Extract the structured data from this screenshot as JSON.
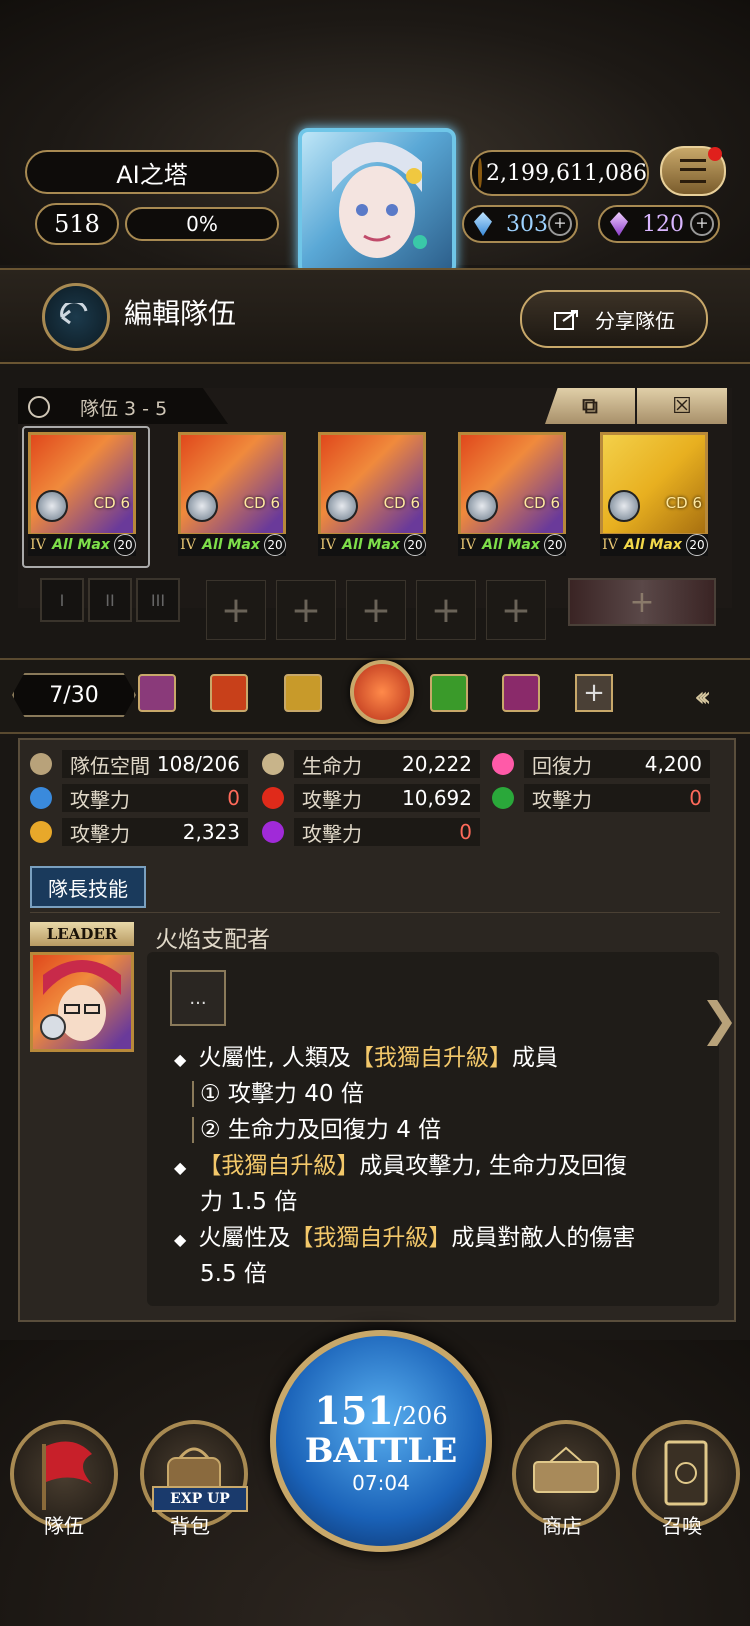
{
  "header": {
    "player_name": "AI之塔",
    "level": "518",
    "exp_percent": "0%",
    "coins": "2,199,611,086",
    "diamonds": "303",
    "crystals": "120"
  },
  "page": {
    "title": "編輯隊伍",
    "share_label": "分享隊伍"
  },
  "team": {
    "label": "隊伍 3 - 5",
    "cards": [
      {
        "rank": "IV",
        "status": "All Max",
        "cd": "CD 6",
        "level": "20",
        "element": "fire"
      },
      {
        "rank": "IV",
        "status": "All Max",
        "cd": "CD 6",
        "level": "20",
        "element": "fire"
      },
      {
        "rank": "IV",
        "status": "All Max",
        "cd": "CD 6",
        "level": "20",
        "element": "fire"
      },
      {
        "rank": "IV",
        "status": "All Max",
        "cd": "CD 6",
        "level": "20",
        "element": "fire"
      },
      {
        "rank": "IV",
        "status": "All Max",
        "cd": "CD 6",
        "level": "20",
        "element": "light"
      }
    ],
    "small_slots": [
      "I",
      "II",
      "III"
    ],
    "plus_slots": [
      "+",
      "+",
      "+",
      "+",
      "+"
    ]
  },
  "team_selector": {
    "count": "7/30",
    "colors": [
      "#8a3a7a",
      "#c8401a",
      "#c89a2a",
      "#e05a2a",
      "#3a9a2a",
      "#8a2a6a"
    ]
  },
  "stats": {
    "rows": [
      [
        {
          "label": "隊伍空間",
          "value": "108/206",
          "icon": "banner-icon",
          "color": "#b8a27a"
        },
        {
          "label": "生命力",
          "value": "20,222",
          "icon": "drop-icon",
          "color": "#c8b48a"
        },
        {
          "label": "回復力",
          "value": "4,200",
          "icon": "heart-icon",
          "color": "#ff5aa8"
        }
      ],
      [
        {
          "label": "攻擊力",
          "value": "0",
          "icon": "water-icon",
          "color": "#3a8adc",
          "zero": true
        },
        {
          "label": "攻擊力",
          "value": "10,692",
          "icon": "fire-icon",
          "color": "#e02a1a"
        },
        {
          "label": "攻擊力",
          "value": "0",
          "icon": "wood-icon",
          "color": "#2aa83a",
          "zero": true
        }
      ],
      [
        {
          "label": "攻擊力",
          "value": "2,323",
          "icon": "light-icon",
          "color": "#e8a82a"
        },
        {
          "label": "攻擊力",
          "value": "0",
          "icon": "dark-icon",
          "color": "#a02ad8",
          "zero": true
        }
      ]
    ]
  },
  "leader": {
    "tab_label": "隊長技能",
    "badge": "LEADER",
    "skill_name": "火焰支配者",
    "ellipsis": "...",
    "lines": [
      {
        "bullet": "◆",
        "parts": [
          {
            "t": "火屬性, 人類及"
          },
          {
            "t": "【我獨自升級】",
            "hl": true
          },
          {
            "t": "成員"
          }
        ]
      },
      {
        "bullet": "",
        "parts": [
          {
            "t": "① 攻擊力 40 倍"
          }
        ],
        "indent": true
      },
      {
        "bullet": "",
        "parts": [
          {
            "t": "② 生命力及回復力 4 倍"
          }
        ],
        "indent": true
      },
      {
        "bullet": "◆",
        "parts": [
          {
            "t": "【我獨自升級】",
            "hl": true
          },
          {
            "t": "成員攻擊力, 生命力及回復"
          }
        ]
      },
      {
        "bullet": "",
        "parts": [
          {
            "t": "力 1.5 倍"
          }
        ]
      },
      {
        "bullet": "◆",
        "parts": [
          {
            "t": "火屬性及"
          },
          {
            "t": "【我獨自升級】",
            "hl": true
          },
          {
            "t": "成員對敵人的傷害"
          }
        ]
      },
      {
        "bullet": "",
        "parts": [
          {
            "t": "5.5 倍"
          }
        ]
      }
    ]
  },
  "bottom_nav": {
    "team": "隊伍",
    "bag": "背包",
    "exp_up": "EXP UP",
    "stamina": "151",
    "stamina_max": "/206",
    "battle": "BATTLE",
    "timer": "07:04",
    "shop": "商店",
    "summon": "召喚"
  }
}
